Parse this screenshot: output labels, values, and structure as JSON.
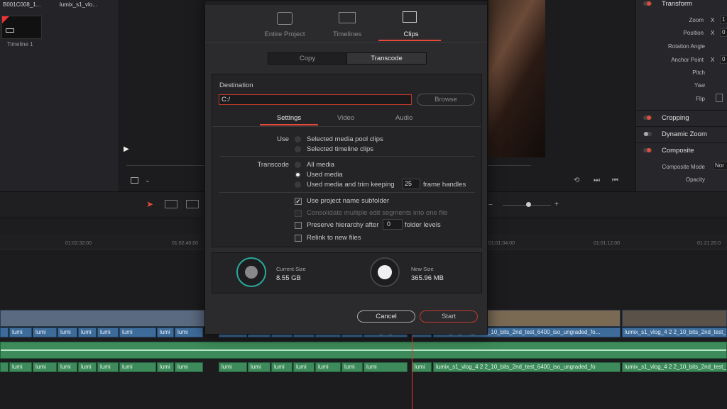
{
  "media_pool": {
    "clip1_name": "B001C008_1...",
    "clip2_name": "lumix_s1_vlo...",
    "timeline_name": "Timeline 1"
  },
  "inspector": {
    "transform_title": "Transform",
    "zoom_label": "Zoom",
    "position_label": "Position",
    "rotation_label": "Rotation Angle",
    "anchor_label": "Anchor Point",
    "pitch_label": "Pitch",
    "yaw_label": "Yaw",
    "flip_label": "Flip",
    "x_axis": "X",
    "zoom_value": "1",
    "position_value": "0",
    "anchor_value": "0",
    "cropping_title": "Cropping",
    "dynamic_zoom_title": "Dynamic Zoom",
    "composite_title": "Composite",
    "composite_mode_label": "Composite Mode",
    "composite_mode_value": "Nor",
    "opacity_label": "Opacity"
  },
  "timeline": {
    "timecodes": [
      "01:02:32:00",
      "01:02:40:00",
      "01:01:04:00",
      "01:01:12:00",
      "01:21:20:0"
    ],
    "short_clip_label": "lumi",
    "clip_label_v": "lumix_s1_v...",
    "long_clip_label": "lumix_s1_vlog_4 2 2_10_bits_2nd_test_6400_iso_ungraded_fo...",
    "long_clip_label2": "lumix_s1_vlog_4 2 2_10_bits_2nd_test_6400_iso_ungraded_fo"
  },
  "modal": {
    "title": "Media Management",
    "tabs": [
      {
        "label": "Entire Project",
        "active": false
      },
      {
        "label": "Timelines",
        "active": false
      },
      {
        "label": "Clips",
        "active": true
      }
    ],
    "mode_copy": "Copy",
    "mode_transcode": "Transcode",
    "destination_label": "Destination",
    "destination_value": "C:/",
    "browse_label": "Browse",
    "subtabs": [
      "Settings",
      "Video",
      "Audio"
    ],
    "use_label": "Use",
    "use_options": [
      "Selected media pool clips",
      "Selected timeline clips"
    ],
    "transcode_label": "Transcode",
    "transcode_options": [
      "All media",
      "Used media",
      "Used media and trim keeping"
    ],
    "frame_handles_value": "25",
    "frame_handles_suffix": "frame handles",
    "use_project_subfolder": "Use project name subfolder",
    "consolidate": "Consolidate multiple edit segments into one file",
    "preserve_prefix": "Preserve hierarchy after",
    "preserve_value": "0",
    "preserve_suffix": "folder levels",
    "relink": "Relink to new files",
    "current_size_label": "Current Size",
    "current_size_value": "8.55 GB",
    "new_size_label": "New Size",
    "new_size_value": "365.96 MB",
    "cancel_label": "Cancel",
    "start_label": "Start"
  },
  "colors": {
    "accent_red": "#e64a3a",
    "teal_ring": "#2aa89a",
    "video_clip": "#3e6c9a",
    "audio_clip": "#3d8a5a"
  }
}
